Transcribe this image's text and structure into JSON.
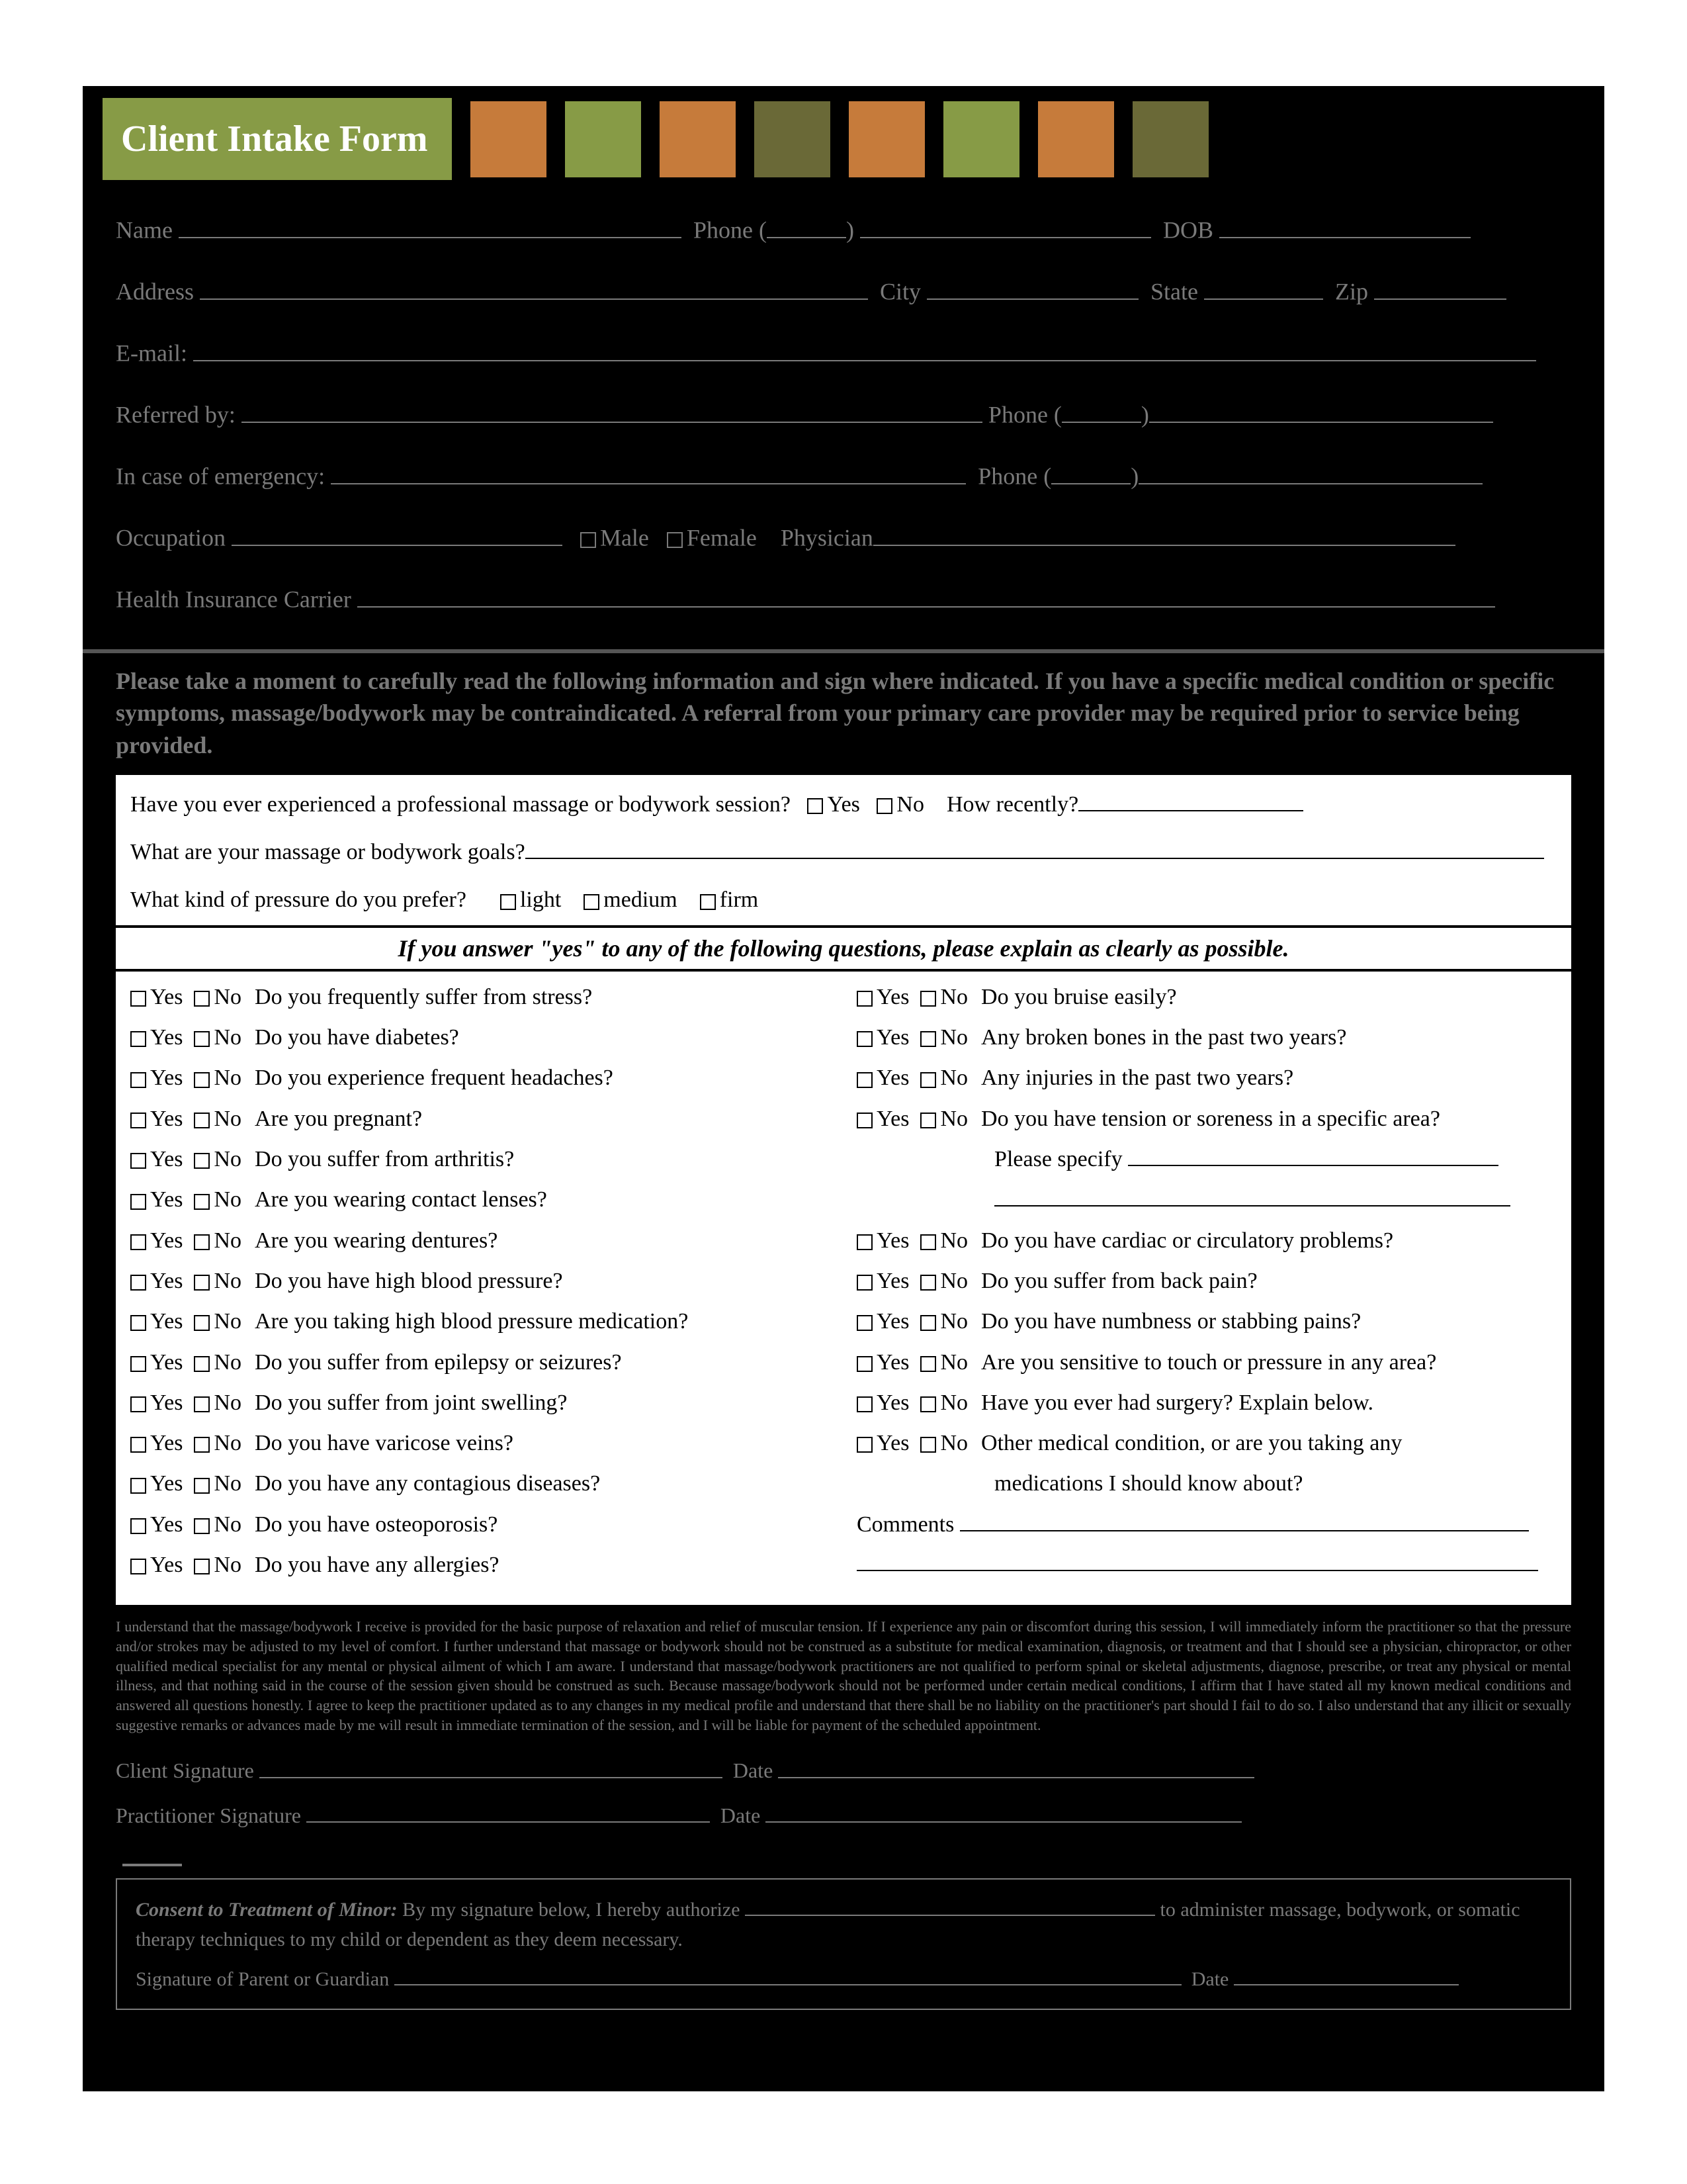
{
  "title": "Client Intake Form",
  "squareColors": [
    "#c67b3b",
    "#879b46",
    "#c67b3b",
    "#6a6937",
    "#c67b3b",
    "#879b46",
    "#c67b3b",
    "#6a6937"
  ],
  "fields": {
    "name": "Name",
    "phone": "Phone (",
    "phoneClose": ")",
    "dob": "DOB",
    "address": "Address",
    "city": "City",
    "state": "State",
    "zip": "Zip",
    "email": "E-mail:",
    "referred": "Referred by:",
    "phone2": "Phone (",
    "phone2Close": ")",
    "emergency": "In case of emergency:",
    "phone3": "Phone (",
    "phone3Close": ")",
    "occupation": "Occupation",
    "male": "Male",
    "female": "Female",
    "physician": "Physician",
    "insurance": "Health Insurance Carrier"
  },
  "notice": "Please take a moment to carefully read the following information and sign where indicated. If you have a specific medical condition or specific symptoms, massage/bodywork may be contraindicated. A referral from your primary care provider may be required prior to service being provided.",
  "intro": {
    "q1": "Have you ever experienced a professional massage or bodywork session?",
    "yes": "Yes",
    "no": "No",
    "recent": "How recently?",
    "goals": "What are your massage or bodywork goals?",
    "pressure": "What kind of pressure do you prefer?",
    "light": "light",
    "medium": "medium",
    "firm": "firm"
  },
  "subhead": "If you answer \"yes\" to any of the following questions, please explain as clearly as possible.",
  "yesLabel": "Yes",
  "noLabel": "No",
  "leftQuestions": [
    "Do you frequently suffer from stress?",
    "Do you have diabetes?",
    "Do you experience frequent headaches?",
    "Are you pregnant?",
    "Do you suffer from arthritis?",
    "Are you wearing contact lenses?",
    "Are you wearing dentures?",
    "Do you have high blood pressure?",
    "Are you taking high blood pressure medication?",
    "Do you suffer from epilepsy or seizures?",
    "Do you suffer from joint swelling?",
    "Do you have varicose veins?",
    "Do you have any contagious diseases?",
    "Do you have osteoporosis?",
    "Do you have any allergies?"
  ],
  "rightQuestions": [
    "Do you bruise easily?",
    "Any broken bones in the past two years?",
    "Any injuries in the past two years?",
    "Do you have tension or soreness in a specific area?"
  ],
  "specify": "Please specify",
  "rightQuestions2": [
    "Do you have cardiac or circulatory problems?",
    "Do you suffer from back pain?",
    "Do you have numbness or stabbing pains?",
    "Are you sensitive to touch or pressure in any area?",
    "Have you ever had surgery? Explain below.",
    "Other medical condition, or are you taking any medications I should know about?"
  ],
  "comments": "Comments",
  "disclaimer": "I understand that the massage/bodywork I receive is provided for the basic purpose of relaxation and relief of muscular tension. If I experience any pain or discomfort during this session, I will immediately inform the practitioner so that the pressure and/or strokes may be adjusted to my level of comfort. I further understand that massage or bodywork should not be construed as a substitute for medical examination, diagnosis, or treatment and that I should see a physician, chiropractor, or other qualified medical specialist for any mental or physical ailment of which I am aware. I understand that massage/bodywork practitioners are not qualified to perform spinal or skeletal adjustments, diagnose, prescribe, or treat any physical or mental illness, and that nothing said in the course of the session given should be construed as such. Because massage/bodywork should not be performed under certain medical conditions, I affirm that I have stated all my known medical conditions and answered all questions honestly. I agree to keep the practitioner updated as to any changes in my medical profile and understand that there shall be no liability on the practitioner's part should I fail to do so. I also understand that any illicit or sexually suggestive remarks or advances made by me will result in immediate termination of the session, and I will be liable for payment of the scheduled appointment.",
  "sigs": {
    "client": "Client Signature",
    "date": "Date",
    "practitioner": "Practitioner Signature"
  },
  "minor": {
    "title": "Consent to Treatment of Minor:",
    "body1": "By my signature below, I hereby authorize",
    "body2": "to administer massage, bodywork, or somatic therapy techniques to my child or dependent as they deem necessary.",
    "sig": "Signature of Parent or Guardian",
    "date": "Date"
  }
}
